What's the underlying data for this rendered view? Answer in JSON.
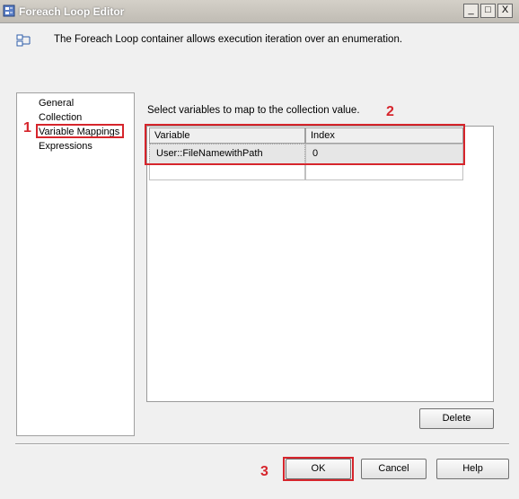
{
  "window": {
    "title": "Foreach Loop Editor"
  },
  "titlebar_controls": {
    "minimize": "_",
    "maximize": "□",
    "close": "X"
  },
  "header": {
    "description": "The Foreach Loop container allows execution iteration over an enumeration.",
    "icon": "foreach-container-icon"
  },
  "nav": {
    "items": [
      {
        "label": "General"
      },
      {
        "label": "Collection"
      },
      {
        "label": "Variable Mappings",
        "selected": true
      },
      {
        "label": "Expressions"
      }
    ]
  },
  "content": {
    "instruction": "Select variables to map to the collection value.",
    "grid": {
      "columns": [
        "Variable",
        "Index"
      ],
      "rows": [
        {
          "variable": "User::FileNamewithPath",
          "index": "0"
        },
        {
          "variable": "",
          "index": ""
        }
      ]
    },
    "delete_label": "Delete"
  },
  "annotations": {
    "step1": "1",
    "step2": "2",
    "step3": "3",
    "color": "#d6252c"
  },
  "buttons": {
    "ok": "OK",
    "cancel": "Cancel",
    "help": "Help"
  }
}
